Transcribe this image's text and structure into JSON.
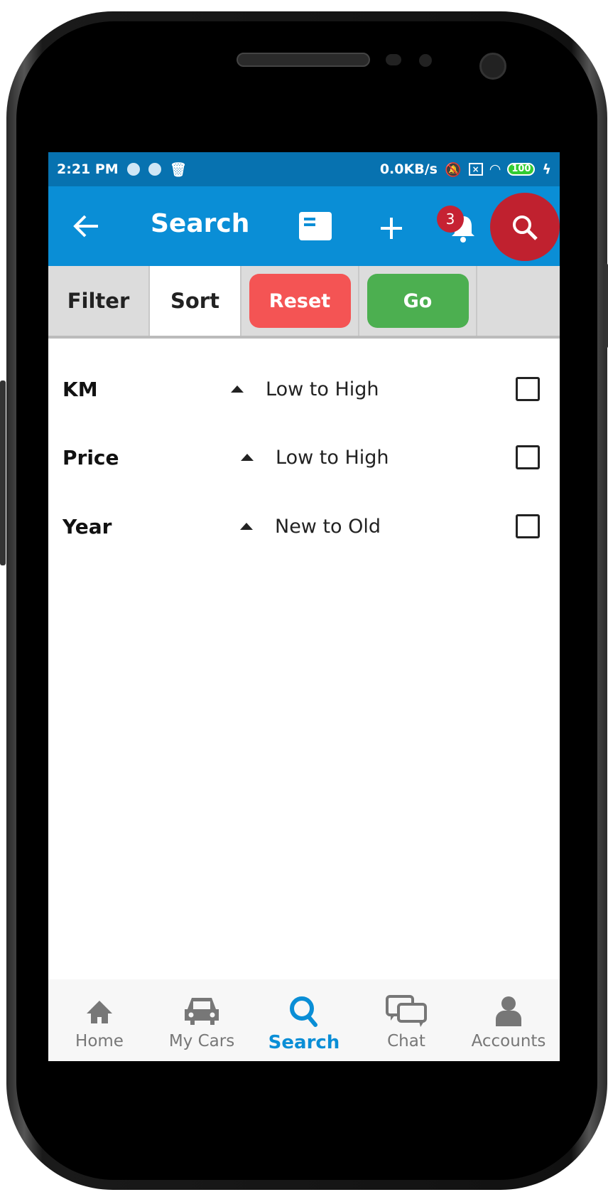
{
  "status_bar": {
    "time": "2:21 PM",
    "network_speed": "0.0KB/s",
    "battery": "100"
  },
  "app_bar": {
    "title": "Search",
    "notification_count": "3"
  },
  "tabs": {
    "filter": "Filter",
    "sort": "Sort",
    "reset": "Reset",
    "go": "Go",
    "active": "Sort"
  },
  "colors": {
    "primary": "#0a8ed6",
    "reset": "#f45454",
    "go": "#4caf50",
    "fab": "#c0212f"
  },
  "sort_options": [
    {
      "label": "KM",
      "order": "Low to High",
      "checked": false
    },
    {
      "label": "Price",
      "order": "Low to High",
      "checked": false
    },
    {
      "label": "Year",
      "order": "New to Old",
      "checked": false
    }
  ],
  "bottom_nav": [
    {
      "label": "Home",
      "icon": "home-icon"
    },
    {
      "label": "My Cars",
      "icon": "car-icon"
    },
    {
      "label": "Search",
      "icon": "search-icon",
      "active": true
    },
    {
      "label": "Chat",
      "icon": "chat-icon"
    },
    {
      "label": "Accounts",
      "icon": "person-icon"
    }
  ]
}
